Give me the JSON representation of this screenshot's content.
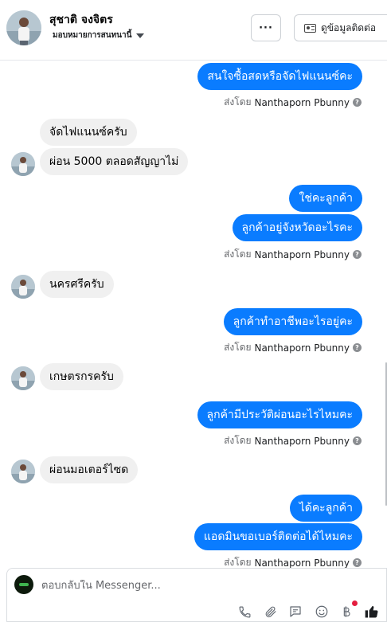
{
  "header": {
    "name": "สุชาติ จงจิตร",
    "assign_label": "มอบหมายการสนทนานี้",
    "more_label": "···",
    "contact_label": "ดูข้อมูลติดต่อ"
  },
  "messages": [
    {
      "side": "out",
      "text": "สนใจซื้อสดหรือจัดไฟแนนซ์คะ"
    },
    {
      "side": "in",
      "text": "จัดไฟแนนซ์ครับ"
    },
    {
      "side": "in",
      "text": "ผ่อน 5000 ตลอดสัญญาไม่"
    },
    {
      "side": "out",
      "text": "ใช่คะลูกค้า"
    },
    {
      "side": "out",
      "text": "ลูกค้าอยู่จังหวัดอะไรคะ"
    },
    {
      "side": "in",
      "text": "นครศรีครับ"
    },
    {
      "side": "out",
      "text": "ลูกค้าทำอาชีพอะไรอยู่คะ"
    },
    {
      "side": "in",
      "text": "เกษตรกรครับ"
    },
    {
      "side": "out",
      "text": "ลูกค้ามีประวัติผ่อนอะไรไหมคะ"
    },
    {
      "side": "in",
      "text": "ผ่อนมอเตอร์ไซด"
    },
    {
      "side": "out",
      "text": "ได้คะลูกค้า"
    },
    {
      "side": "out",
      "text": "แอดมินขอเบอร์ติดต่อได้ไหมคะ"
    }
  ],
  "sent_by": {
    "prefix": "ส่งโดย",
    "sender": "Nanthaporn Pbunny",
    "info": "?"
  },
  "composer": {
    "placeholder": "ตอบกลับใน Messenger..."
  },
  "toolbar_icons": [
    "phone-icon",
    "paperclip-icon",
    "saved-reply-icon",
    "emoji-icon",
    "baht-payment-icon",
    "thumbs-up-icon"
  ],
  "colors": {
    "outgoing_bubble": "#0a7cff",
    "incoming_bubble": "#f0f0f0",
    "notification_dot": "#e41e3f"
  }
}
